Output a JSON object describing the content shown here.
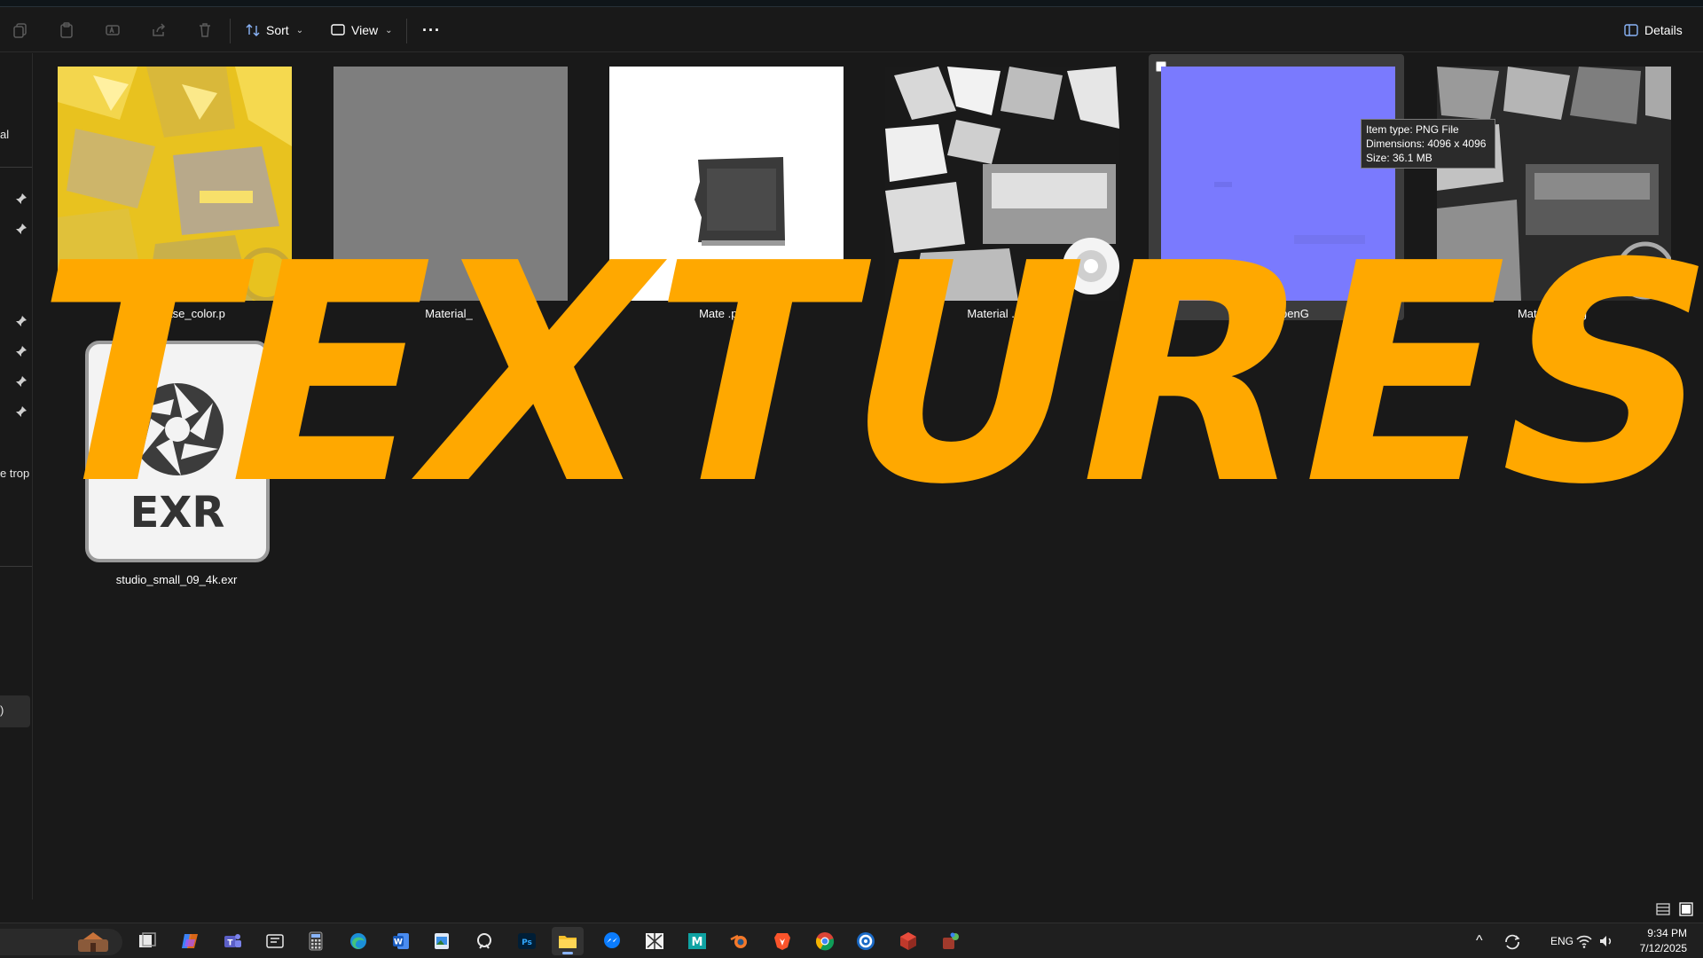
{
  "toolbar": {
    "sort_label": "Sort",
    "view_label": "View",
    "more_label": "···",
    "details_label": "Details"
  },
  "sidebar": {
    "partial_label_1": "al",
    "partial_label_2": "e trop",
    "partial_label_3": ")"
  },
  "files": [
    {
      "label": "aterial_Base_color.p",
      "kind": "yellow-texture"
    },
    {
      "label": "Material_",
      "kind": "gray-texture"
    },
    {
      "label": "Mate            .png",
      "kind": "white-mask"
    },
    {
      "label": "Material          .png",
      "kind": "ao-texture"
    },
    {
      "label": "M             al_OpenG",
      "kind": "normal-map",
      "selected": true
    },
    {
      "label": "Mate           ess.png",
      "kind": "roughness"
    }
  ],
  "tooltip": {
    "line1": "Item type: PNG File",
    "line2": "Dimensions: 4096 x 4096",
    "line3": "Size: 36.1 MB"
  },
  "exr_file": {
    "badge": "EXR",
    "label": "studio_small_09_4k.exr"
  },
  "overlay": {
    "title": "TEXTURES",
    "color": "#ffa800"
  },
  "taskbar": {
    "lang": "ENG",
    "time": "9:34 PM",
    "date": "7/12/2025"
  },
  "colors": {
    "background": "#191919",
    "normal_map": "#7a7afe",
    "selection": "#3c3c3c",
    "accent": "#ffa800"
  }
}
